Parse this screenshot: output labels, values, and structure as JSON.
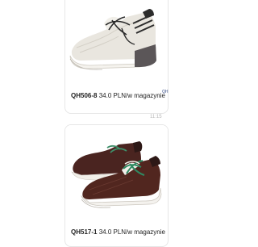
{
  "messages": [
    {
      "product_code": "QH506-8",
      "details": " 34.0 PLN/w magazynie",
      "image": "white-grey-sneaker-photo"
    },
    {
      "product_code": "QH517-1",
      "details": " 34.0 PLN/w magazynie",
      "image": "brown-green-sneakers-photo"
    }
  ],
  "timestamp": "11:15",
  "side_tag": "QH",
  "colors": {
    "card_border": "#e6e6e6",
    "timestamp": "#b5b5b5",
    "text": "#222222"
  }
}
